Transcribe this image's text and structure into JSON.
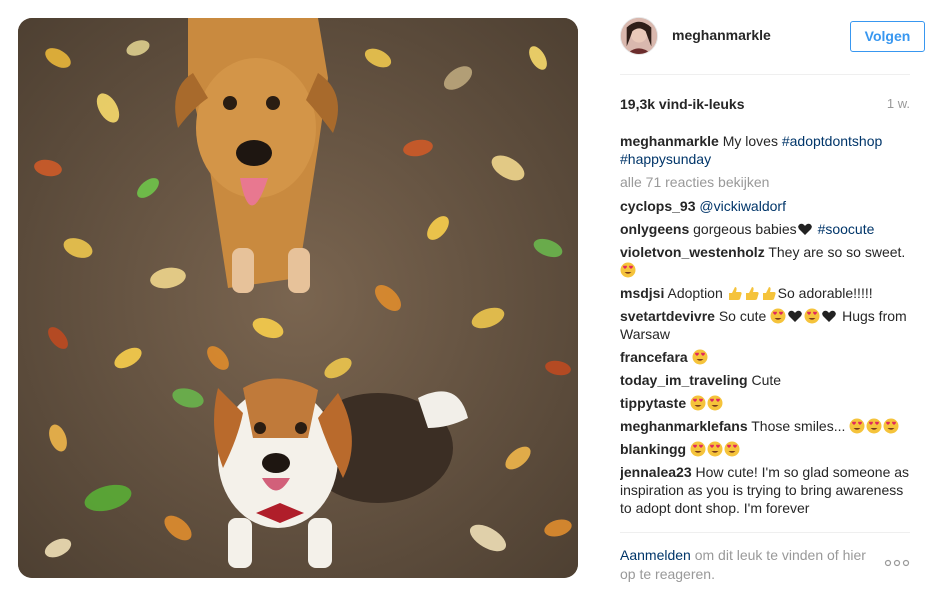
{
  "post": {
    "username": "meghanmarkle",
    "follow_label": "Volgen",
    "likes": "19,3k vind-ik-leuks",
    "time": "1 w.",
    "caption": {
      "user": "meghanmarkle",
      "text": "My loves ",
      "hashtag1": "#adoptdontshop",
      "hashtag2": "#happysunday"
    },
    "view_all": "alle 71 reacties bekijken",
    "comments": [
      {
        "user": "cyclops_93",
        "mention": "@vickiwaldorf"
      },
      {
        "user": "onlygeens",
        "text": "gorgeous babies",
        "hashtag": "#soocute"
      },
      {
        "user": "violetvon_westenholz",
        "text": "They are so so sweet."
      },
      {
        "user": "msdjsi",
        "text1": "Adoption ",
        "text2": "So adorable!!!!!"
      },
      {
        "user": "svetartdevivre",
        "text1": "So cute ",
        "text2": " Hugs from Warsaw"
      },
      {
        "user": "francefara"
      },
      {
        "user": "today_im_traveling",
        "text": "Cute"
      },
      {
        "user": "tippytaste"
      },
      {
        "user": "meghanmarklefans",
        "text": "Those smiles..."
      },
      {
        "user": "blankingg"
      },
      {
        "user": "jennalea23",
        "text": "How cute! I'm so glad someone as inspiration as you is trying to bring awareness to adopt dont shop. I'm forever"
      }
    ],
    "login_link": "Aanmelden",
    "login_text": " om dit leuk te vinden of hier op te reageren."
  },
  "icons": {
    "heart_eyes": "heart-eyes-emoji",
    "heart": "heart-emoji",
    "thumbs": "thumbs-up-emoji",
    "more": "more-options-icon"
  },
  "colors": {
    "link": "#003569",
    "button": "#3897f0",
    "muted": "#999999",
    "text": "#262626"
  }
}
